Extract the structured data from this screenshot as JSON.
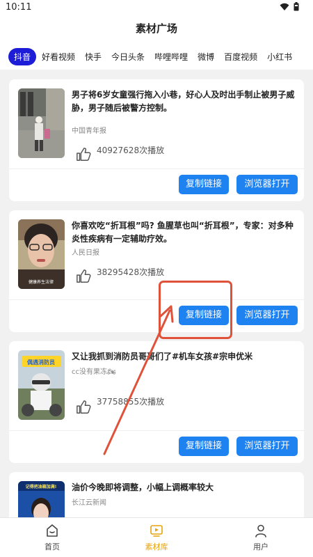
{
  "status_bar": {
    "time": "10:11",
    "icons": [
      "wifi-icon",
      "battery-icon"
    ]
  },
  "header": {
    "title": "素材广场"
  },
  "tabs": [
    {
      "label": "抖音",
      "active": true
    },
    {
      "label": "好看视频"
    },
    {
      "label": "快手"
    },
    {
      "label": "今日头条"
    },
    {
      "label": "哔哩哔哩"
    },
    {
      "label": "微博"
    },
    {
      "label": "百度视频"
    },
    {
      "label": "小红书"
    }
  ],
  "cards": [
    {
      "title": "男子将6岁女童强行拖入小巷，好心人及时出手制止被男子威胁，男子随后被警方控制。",
      "source": "中国青年报",
      "plays": "40927628次播放",
      "copy_label": "复制链接",
      "open_label": "浏览器打开"
    },
    {
      "title": "你喜欢吃“折耳根”吗? 鱼腥草也叫“折耳根”，专家：对多种炎性疾病有一定辅助疗效。",
      "source": "人民日报",
      "plays": "38295428次播放",
      "copy_label": "复制链接",
      "open_label": "浏览器打开",
      "thumb_caption": "健康养生法律"
    },
    {
      "title": "又让我抓到消防员哥哥们了#机车女孩#宗申优米",
      "source": "cc没有果冻🏍",
      "plays": "37758855次播放",
      "copy_label": "复制链接",
      "open_label": "浏览器打开",
      "thumb_caption": "偶遇消防员"
    },
    {
      "title": "油价今晚即将调整，小幅上调概率较大",
      "source": "长江云新闻",
      "thumb_caption": "记得把油箱加满!"
    }
  ],
  "bottom_nav": [
    {
      "label": "首页",
      "icon": "home-icon"
    },
    {
      "label": "素材库",
      "icon": "play-screen-icon",
      "active": true
    },
    {
      "label": "用户",
      "icon": "user-icon"
    }
  ],
  "colors": {
    "accent_tab": "#1d1dd8",
    "button": "#1e82f0",
    "active_nav": "#e7a20c",
    "annotation": "#e0513a"
  }
}
